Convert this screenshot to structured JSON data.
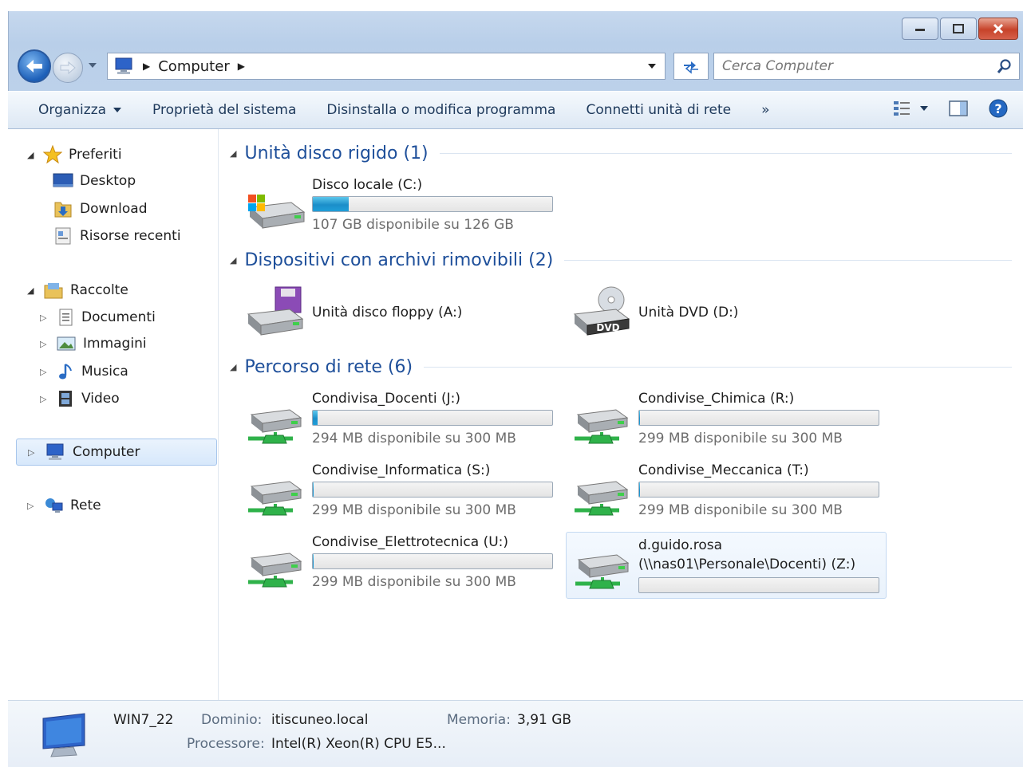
{
  "window": {
    "controls": {
      "minimize": "minimize",
      "maximize": "maximize",
      "close": "close"
    }
  },
  "address": {
    "location": "Computer",
    "search_placeholder": "Cerca Computer"
  },
  "toolbar": {
    "organize": "Organizza",
    "system_properties": "Proprietà del sistema",
    "uninstall": "Disinstalla o modifica programma",
    "map_drive": "Connetti unità di rete",
    "more": "»"
  },
  "sidebar": {
    "favorites": "Preferiti",
    "desktop": "Desktop",
    "download": "Download",
    "recent": "Risorse recenti",
    "libraries": "Raccolte",
    "documents": "Documenti",
    "pictures": "Immagini",
    "music": "Musica",
    "video": "Video",
    "computer": "Computer",
    "network": "Rete"
  },
  "groups": {
    "hdd": "Unità disco rigido (1)",
    "removable": "Dispositivi con archivi rimovibili (2)",
    "network": "Percorso di rete (6)"
  },
  "drives": {
    "c": {
      "name": "Disco locale (C:)",
      "free": "107 GB disponibile su 126 GB",
      "used_fraction": 0.15
    },
    "a": {
      "name": "Unità disco floppy (A:)"
    },
    "d": {
      "name": "Unità DVD (D:)",
      "badge": "DVD"
    },
    "j": {
      "name": "Condivisa_Docenti (J:)",
      "free": "294 MB disponibile su 300 MB",
      "used_fraction": 0.02
    },
    "r": {
      "name": "Condivise_Chimica (R:)",
      "free": "299 MB disponibile su 300 MB",
      "used_fraction": 0.003
    },
    "s": {
      "name": "Condivise_Informatica (S:)",
      "free": "299 MB disponibile su 300 MB",
      "used_fraction": 0.003
    },
    "t": {
      "name": "Condivise_Meccanica (T:)",
      "free": "299 MB disponibile su 300 MB",
      "used_fraction": 0.003
    },
    "u": {
      "name": "Condivise_Elettrotecnica (U:)",
      "free": "299 MB disponibile su 300 MB",
      "used_fraction": 0.003
    },
    "z": {
      "name_line1": "d.guido.rosa",
      "name_line2": "(\\\\nas01\\Personale\\Docenti) (Z:)",
      "used_fraction": 0.0
    }
  },
  "details": {
    "computer_name": "WIN7_22",
    "domain_label": "Dominio:",
    "domain_value": "itiscuneo.local",
    "memory_label": "Memoria:",
    "memory_value": "3,91 GB",
    "cpu_label": "Processore:",
    "cpu_value": "Intel(R) Xeon(R) CPU E5..."
  },
  "colors": {
    "accent": "#1e4f9a",
    "bar_fill": "#1b8ec9",
    "share_green": "#2fb24a"
  }
}
